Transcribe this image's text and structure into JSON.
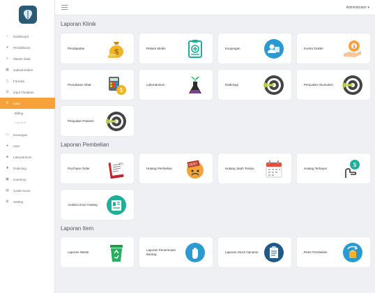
{
  "header": {
    "user_menu": "Administrator ▾"
  },
  "sidebar": {
    "items": [
      {
        "label": "Dashboard",
        "icon": "home-icon"
      },
      {
        "label": "Pendaftaran",
        "icon": "user-icon"
      },
      {
        "label": "Master Data",
        "icon": "database-icon"
      },
      {
        "label": "Jadwal Dokter",
        "icon": "calendar-icon"
      },
      {
        "label": "Farmasi",
        "icon": "flask-icon"
      },
      {
        "label": "Input Tindakan",
        "icon": "list-icon"
      },
      {
        "label": "Kasir",
        "icon": "cash-icon"
      },
      {
        "label": "Billing",
        "icon": ""
      },
      {
        "label": "Laporan",
        "icon": ""
      },
      {
        "label": "Keuangan",
        "icon": "money-icon"
      },
      {
        "label": "User",
        "icon": "users-icon"
      },
      {
        "label": "Laboratorium",
        "icon": "lab-icon"
      },
      {
        "label": "Radiologi",
        "icon": "radiology-icon"
      },
      {
        "label": "Inventory",
        "icon": "box-icon"
      },
      {
        "label": "Cetak Surat",
        "icon": "print-icon"
      },
      {
        "label": "Setting",
        "icon": "gear-icon"
      }
    ]
  },
  "sections": {
    "klinik": {
      "title": "Laporan Klinik",
      "cards": [
        "Pendapatan",
        "Rekam Medis",
        "Kunjungan",
        "Komisi Dokter",
        "Pemakaian Obat",
        "Laboratorium",
        "Radiologi",
        "Penjualan Akumulasi",
        "Penjualan Pantiem"
      ]
    },
    "pembelian": {
      "title": "Laporan Pembelian",
      "cards": [
        "Purchase Order",
        "Hutang Pembelian",
        "Hutang Jatuh Tempo",
        "Hutang Terbayar",
        "Analisa Umur Hutang"
      ]
    },
    "item": {
      "title": "Laporan Item",
      "cards": [
        "Laporan Waste",
        "Laporan Penerimaan Barang",
        "Laporan Stock Opname",
        "Retur Pembelian"
      ]
    }
  },
  "colors": {
    "accent": "#f7a13a",
    "brand": "#2b5a75",
    "icon_blue": "#2a9ad0",
    "icon_teal": "#1fae9a"
  }
}
